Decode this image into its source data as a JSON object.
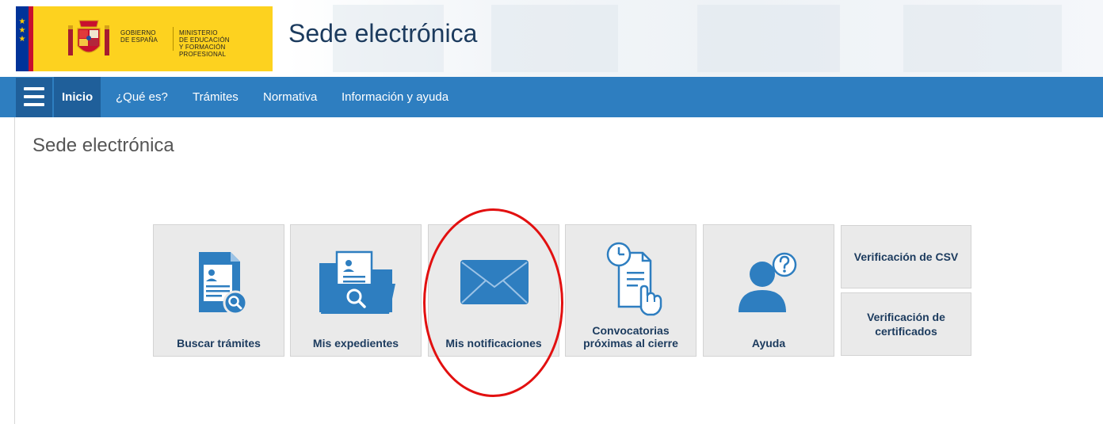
{
  "header": {
    "gov_line1": "GOBIERNO",
    "gov_line2": "DE ESPAÑA",
    "ministry_line1": "MINISTERIO",
    "ministry_line2": "DE EDUCACIÓN",
    "ministry_line3": "Y FORMACIÓN PROFESIONAL",
    "site_title": "Sede electrónica"
  },
  "nav": {
    "items": [
      {
        "label": "Inicio",
        "active": true
      },
      {
        "label": "¿Qué es?"
      },
      {
        "label": "Trámites"
      },
      {
        "label": "Normativa"
      },
      {
        "label": "Información y ayuda"
      }
    ]
  },
  "main": {
    "page_title": "Sede electrónica",
    "tiles": [
      {
        "label": "Buscar trámites",
        "icon": "document-search-icon"
      },
      {
        "label": "Mis expedientes",
        "icon": "folder-search-icon"
      },
      {
        "label": "Mis notificaciones",
        "icon": "envelope-icon"
      },
      {
        "label_line1": "Convocatorias",
        "label_line2": "próximas al cierre",
        "icon": "clock-document-hand-icon"
      },
      {
        "label": "Ayuda",
        "icon": "user-help-icon"
      }
    ],
    "small_tiles": [
      {
        "label": "Verificación de CSV"
      },
      {
        "label_line1": "Verificación de",
        "label_line2": "certificados"
      }
    ]
  },
  "colors": {
    "nav_bar": "#2e7ec0",
    "nav_active": "#1f5f9a",
    "icon_blue": "#2e7ec0",
    "tile_bg": "#eaeaea",
    "label_color": "#1c3b5e",
    "highlight": "#e21010",
    "logo_yellow": "#fdd21f"
  }
}
